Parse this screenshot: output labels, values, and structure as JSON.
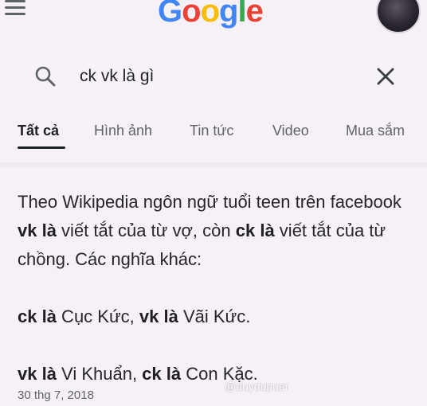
{
  "header": {
    "logo_letters": [
      {
        "char": "G",
        "color": "#4285F4"
      },
      {
        "char": "o",
        "color": "#EA4335"
      },
      {
        "char": "o",
        "color": "#FBBC05"
      },
      {
        "char": "g",
        "color": "#4285F4"
      },
      {
        "char": "l",
        "color": "#34A853"
      },
      {
        "char": "e",
        "color": "#EA4335"
      }
    ]
  },
  "search": {
    "query": "ck vk là gì"
  },
  "tabs": [
    {
      "label": "Tất cả",
      "active": true
    },
    {
      "label": "Hình ảnh",
      "active": false
    },
    {
      "label": "Tin tức",
      "active": false
    },
    {
      "label": "Video",
      "active": false
    },
    {
      "label": "Mua sắm",
      "active": false
    }
  ],
  "result": {
    "p1": {
      "s1": "Theo Wikipedia ngôn ngữ tuổi teen trên facebook ",
      "b1": "vk là",
      "s2": " viết tắt của từ vợ, còn ",
      "b2": "ck là",
      "s3": " viết tắt của từ chồng. Các nghĩa khác:"
    },
    "p2": {
      "b1": "ck là",
      "s1": " Cục Kức, ",
      "b2": "vk là",
      "s2": " Vãi Kức."
    },
    "p3": {
      "b1": "vk là",
      "s1": " Vi Khuẩn, ",
      "b2": "ck là",
      "s2": " Con Kặc."
    },
    "date": "30 thg 7, 2018"
  },
  "watermark": "@duydupuer",
  "colors": {
    "background": "#f6f1f7",
    "text": "#202124",
    "muted": "#5f6368"
  }
}
